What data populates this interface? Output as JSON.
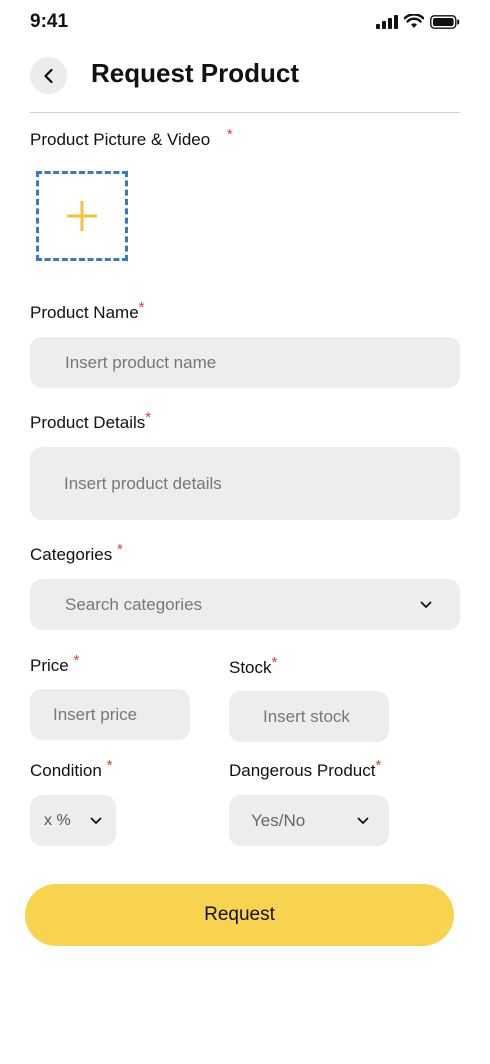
{
  "status_bar": {
    "time": "9:41"
  },
  "header": {
    "title": "Request Product"
  },
  "form": {
    "picture": {
      "label": "Product Picture & Video",
      "required_mark": "*"
    },
    "product_name": {
      "label": "Product Name",
      "required_mark": "*",
      "placeholder": "Insert product name"
    },
    "product_details": {
      "label": "Product Details",
      "required_mark": "*",
      "placeholder": "Insert product details"
    },
    "categories": {
      "label": "Categories",
      "required_mark": "*",
      "placeholder": "Search categories"
    },
    "price": {
      "label": "Price",
      "required_mark": "*",
      "placeholder": "Insert price"
    },
    "stock": {
      "label": "Stock",
      "required_mark": "*",
      "placeholder": "Insert stock"
    },
    "condition": {
      "label": "Condition",
      "required_mark": "*",
      "value": "x %"
    },
    "dangerous": {
      "label": "Dangerous Product",
      "required_mark": "*",
      "value": "Yes/No"
    }
  },
  "actions": {
    "request_label": "Request"
  },
  "colors": {
    "accent": "#f7d34f",
    "required": "#e53935",
    "upload_border": "#3a78c2",
    "field_bg": "#ededed"
  }
}
